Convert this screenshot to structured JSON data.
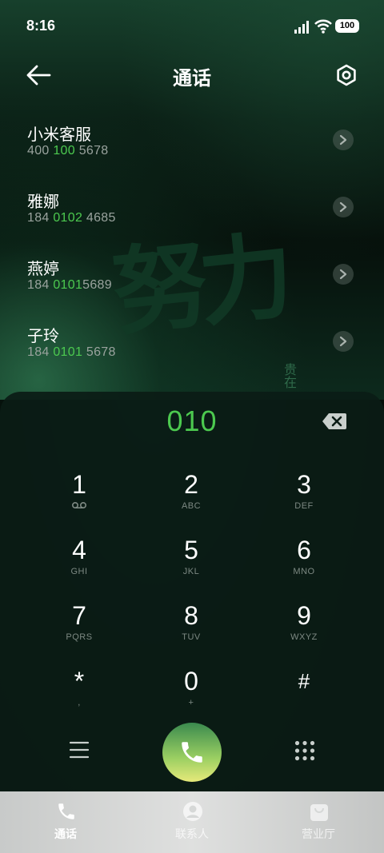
{
  "status_bar": {
    "time": "8:16",
    "battery": "100"
  },
  "header": {
    "title": "通话"
  },
  "results": [
    {
      "name": "小米客服",
      "number_parts": [
        "400 ",
        "100",
        " 5678"
      ]
    },
    {
      "name": "雅娜",
      "number_parts": [
        "184 ",
        "0102",
        " 4685"
      ]
    },
    {
      "name": "燕婷",
      "number_parts": [
        "184 ",
        "0101",
        "5689"
      ]
    },
    {
      "name": "子玲",
      "number_parts": [
        "184 ",
        "0101",
        " 5678"
      ]
    }
  ],
  "background_art": {
    "main": "努力",
    "side": "贵在"
  },
  "dialpad": {
    "input": "010",
    "keys": [
      {
        "digit": "1",
        "letters": ""
      },
      {
        "digit": "2",
        "letters": "ABC"
      },
      {
        "digit": "3",
        "letters": "DEF"
      },
      {
        "digit": "4",
        "letters": "GHI"
      },
      {
        "digit": "5",
        "letters": "JKL"
      },
      {
        "digit": "6",
        "letters": "MNO"
      },
      {
        "digit": "7",
        "letters": "PQRS"
      },
      {
        "digit": "8",
        "letters": "TUV"
      },
      {
        "digit": "9",
        "letters": "WXYZ"
      },
      {
        "digit": "*",
        "letters": ","
      },
      {
        "digit": "0",
        "letters": "+"
      },
      {
        "digit": "#",
        "letters": ""
      }
    ]
  },
  "bottom_nav": {
    "items": [
      {
        "label": "通话",
        "icon": "phone-icon",
        "active": true
      },
      {
        "label": "联系人",
        "icon": "contacts-icon",
        "active": false
      },
      {
        "label": "营业厅",
        "icon": "store-bag-icon",
        "active": false
      }
    ]
  },
  "colors": {
    "accent": "#4cc94f",
    "panel": "#0b1c15"
  }
}
